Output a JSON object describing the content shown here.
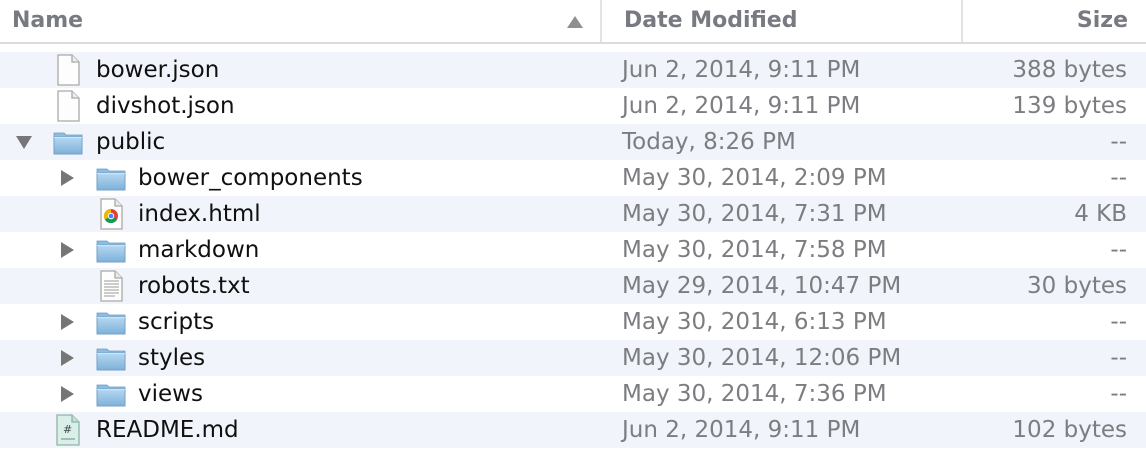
{
  "header": {
    "name": "Name",
    "date_modified": "Date Modified",
    "size": "Size",
    "sort": "name-ascending"
  },
  "rows": [
    {
      "name": "bower.json",
      "date": "Jun 2, 2014, 9:11 PM",
      "size": "388 bytes",
      "kind": "file",
      "icon": "document-icon",
      "level": 0,
      "expanded": null
    },
    {
      "name": "divshot.json",
      "date": "Jun 2, 2014, 9:11 PM",
      "size": "139 bytes",
      "kind": "file",
      "icon": "document-icon",
      "level": 0,
      "expanded": null
    },
    {
      "name": "public",
      "date": "Today, 8:26 PM",
      "size": "--",
      "kind": "folder",
      "icon": "folder-icon",
      "level": 0,
      "expanded": true
    },
    {
      "name": "bower_components",
      "date": "May 30, 2014, 2:09 PM",
      "size": "--",
      "kind": "folder",
      "icon": "folder-icon",
      "level": 1,
      "expanded": false
    },
    {
      "name": "index.html",
      "date": "May 30, 2014, 7:31 PM",
      "size": "4 KB",
      "kind": "file",
      "icon": "html-file-icon",
      "level": 1,
      "expanded": null
    },
    {
      "name": "markdown",
      "date": "May 30, 2014, 7:58 PM",
      "size": "--",
      "kind": "folder",
      "icon": "folder-icon",
      "level": 1,
      "expanded": false
    },
    {
      "name": "robots.txt",
      "date": "May 29, 2014, 10:47 PM",
      "size": "30 bytes",
      "kind": "file",
      "icon": "text-file-icon",
      "level": 1,
      "expanded": null
    },
    {
      "name": "scripts",
      "date": "May 30, 2014, 6:13 PM",
      "size": "--",
      "kind": "folder",
      "icon": "folder-icon",
      "level": 1,
      "expanded": false
    },
    {
      "name": "styles",
      "date": "May 30, 2014, 12:06 PM",
      "size": "--",
      "kind": "folder",
      "icon": "folder-icon",
      "level": 1,
      "expanded": false
    },
    {
      "name": "views",
      "date": "May 30, 2014, 7:36 PM",
      "size": "--",
      "kind": "folder",
      "icon": "folder-icon",
      "level": 1,
      "expanded": false
    },
    {
      "name": "README.md",
      "date": "Jun 2, 2014, 9:11 PM",
      "size": "102 bytes",
      "kind": "file",
      "icon": "markdown-file-icon",
      "level": 0,
      "expanded": null
    }
  ],
  "colors": {
    "header_text": "#777a80",
    "row_alt": "#f1f5fb",
    "secondary_text": "#7b7d80",
    "folder": "#9ec6e6"
  }
}
